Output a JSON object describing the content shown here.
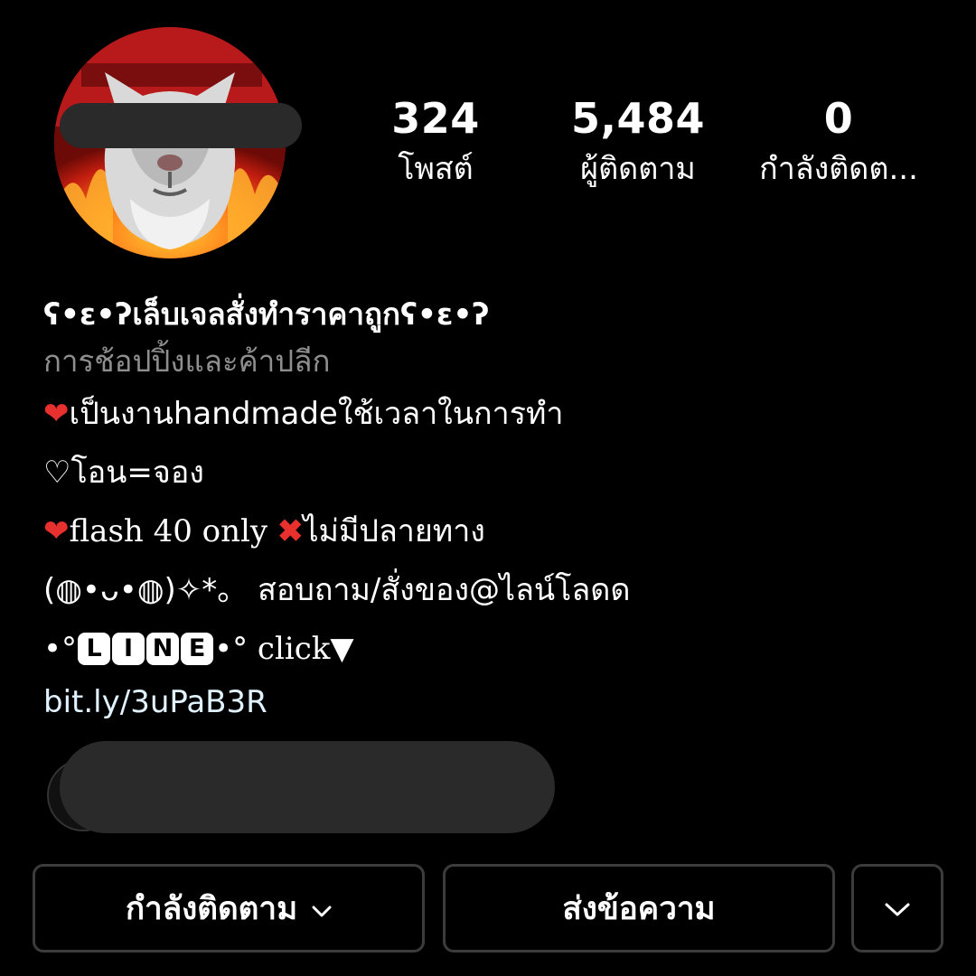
{
  "profile": {
    "stats": {
      "posts": {
        "count": "324",
        "label": "โพสต์"
      },
      "followers": {
        "count": "5,484",
        "label": "ผู้ติดตาม"
      },
      "following": {
        "count": "0",
        "label": "กำลังติดต..."
      }
    },
    "bio": {
      "name": "ʕ•ε•ʔเล็บเจลสั่งทำราคาถูกʕ•ε•ʔ",
      "category": "การช้อปปิ้งและค้าปลีก",
      "line1_heart": "❤",
      "line1_text": "เป็นงานhandmadeใช้เวลาในการทำ",
      "line2_text": "♡โอน=จอง",
      "line3_heart": "❤",
      "line3_text": "flash 40 only ",
      "line3_cross": "✖",
      "line3_tail": "ไม่มีปลายทาง",
      "line4_text": "(◍•ᴗ•◍)✧*。 สอบถาม/สั่งของ@ไลน์โลดด",
      "line5_prefix": "•°",
      "line5_badges": [
        "L",
        "I",
        "N",
        "E"
      ],
      "line5_suffix": "•° click▼",
      "link": "bit.ly/3uPaB3R"
    }
  },
  "actions": {
    "following_label": "กำลังติดตาม",
    "message_label": "ส่งข้อความ"
  },
  "icons": {
    "following_chevron": "chevron-down-icon",
    "more_chevron": "chevron-down-icon"
  },
  "colors": {
    "background": "#000000",
    "category_text": "#8e8e8e",
    "link_text": "#e0f1ff",
    "button_border": "#3c3c3c",
    "heart": "#e8312f"
  }
}
